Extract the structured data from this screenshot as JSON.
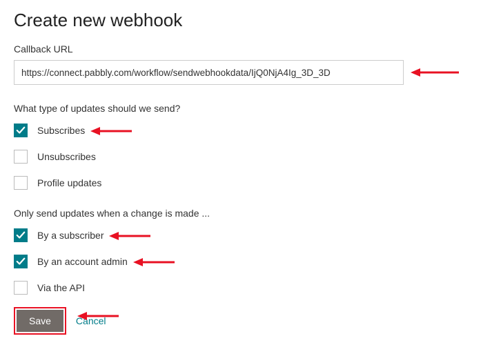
{
  "title": "Create new webhook",
  "callback": {
    "label": "Callback URL",
    "value": "https://connect.pabbly.com/workflow/sendwebhookdata/IjQ0NjA4Ig_3D_3D"
  },
  "updates": {
    "question": "What type of updates should we send?",
    "options": [
      {
        "label": "Subscribes",
        "checked": true,
        "name": "checkbox-subscribes",
        "arrow": true
      },
      {
        "label": "Unsubscribes",
        "checked": false,
        "name": "checkbox-unsubscribes",
        "arrow": false
      },
      {
        "label": "Profile updates",
        "checked": false,
        "name": "checkbox-profile-updates",
        "arrow": false
      }
    ]
  },
  "change": {
    "question": "Only send updates when a change is made ...",
    "options": [
      {
        "label": "By a subscriber",
        "checked": true,
        "name": "checkbox-by-subscriber",
        "arrow": true
      },
      {
        "label": "By an account admin",
        "checked": true,
        "name": "checkbox-by-admin",
        "arrow": true
      },
      {
        "label": "Via the API",
        "checked": false,
        "name": "checkbox-via-api",
        "arrow": false
      }
    ]
  },
  "buttons": {
    "save": "Save",
    "cancel": "Cancel"
  },
  "annotation_color": "#e81123"
}
